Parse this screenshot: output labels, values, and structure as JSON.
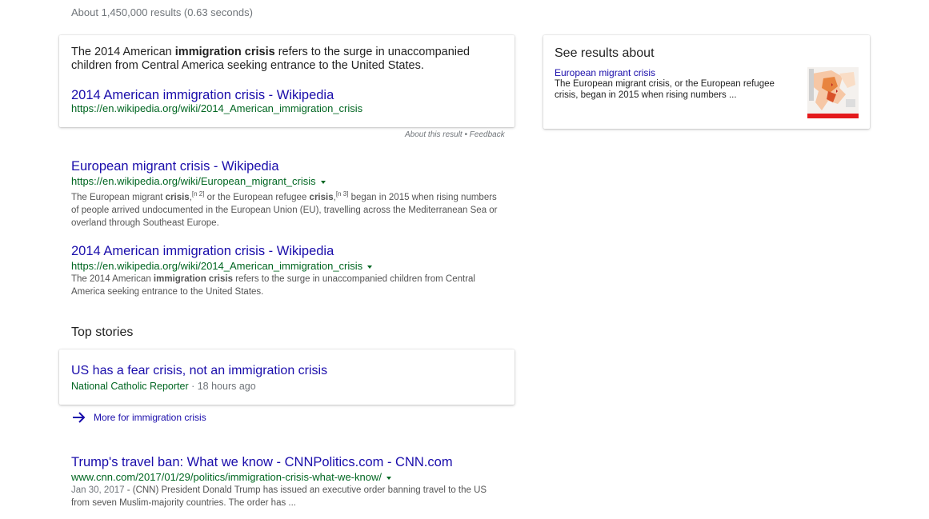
{
  "stats": "About 1,450,000 results (0.63 seconds)",
  "featured": {
    "text_pre": "The 2014 American ",
    "text_bold": "immigration crisis",
    "text_post": " refers to the surge in unaccompanied children from Central America seeking entrance to the United States.",
    "link_title": "2014 American immigration crisis - Wikipedia",
    "link_url": "https://en.wikipedia.org/wiki/2014_American_immigration_crisis",
    "about": "About this result",
    "separator": " • ",
    "feedback": "Feedback"
  },
  "side_panel": {
    "title": "See results about",
    "link": "European migrant crisis",
    "description": "The European migrant crisis, or the European refugee crisis, began in 2015 when rising numbers ..."
  },
  "results": [
    {
      "title": "European migrant crisis - Wikipedia",
      "url": "https://en.wikipedia.org/wiki/European_migrant_crisis",
      "d1": "The European migrant ",
      "b1": "crisis",
      "d2": ",",
      "sup1": "[n 2]",
      "d3": " or the European refugee ",
      "b2": "crisis",
      "d4": ",",
      "sup2": "[n 3]",
      "d5": " began in 2015 when rising numbers of people arrived undocumented in the European Union (EU), travelling across the Mediterranean Sea or overland through Southeast Europe."
    },
    {
      "title": "2014 American immigration crisis - Wikipedia",
      "url": "https://en.wikipedia.org/wiki/2014_American_immigration_crisis",
      "d1": "The 2014 American ",
      "b1": "immigration crisis",
      "d2": " refers to the surge in unaccompanied children from Central America seeking entrance to the United States."
    },
    {
      "title": "Trump's travel ban: What we know - CNNPolitics.com - CNN.com",
      "url": "www.cnn.com/2017/01/29/politics/immigration-crisis-what-we-know/",
      "date": "Jan 30, 2017",
      "d1": " - (CNN) President Donald Trump has issued an executive order banning travel to the US from seven Muslim-majority countries. The order has ..."
    }
  ],
  "top_stories": {
    "heading": "Top stories",
    "story_title": "US has a fear crisis, not an immigration crisis",
    "source": "National Catholic Reporter",
    "time_sep": " · ",
    "time": "18 hours ago",
    "more": "More for immigration crisis"
  },
  "colors": {
    "link": "#1a0dab",
    "url_green": "#006621",
    "meta_gray": "#70757a"
  },
  "icons": [
    "dropdown-caret-icon",
    "arrow-right-icon",
    "map-thumbnail"
  ]
}
